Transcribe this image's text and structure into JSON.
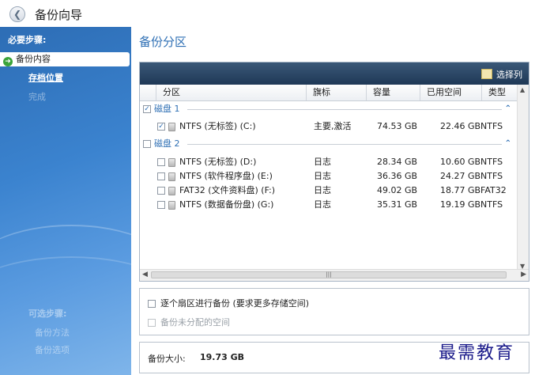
{
  "window": {
    "title": "备份向导"
  },
  "sidebar": {
    "required_heading": "必要步骤:",
    "items": [
      {
        "label": "备份内容",
        "state": "active"
      },
      {
        "label": "存档位置",
        "state": "link"
      },
      {
        "label": "完成",
        "state": "disabled"
      }
    ],
    "optional_heading": "可选步骤:",
    "optional_items": [
      "备份方法",
      "备份选项"
    ]
  },
  "main": {
    "title": "备份分区",
    "toolbar": {
      "select_columns": "选择列"
    },
    "columns": [
      "分区",
      "旗标",
      "容量",
      "已用空间",
      "类型"
    ],
    "disks": [
      {
        "label": "磁盘 1",
        "checked": true,
        "partitions": [
          {
            "name": "NTFS (无标签) (C:)",
            "flag": "主要,激活",
            "capacity": "74.53 GB",
            "used": "22.46 GB",
            "type": "NTFS",
            "checked": true
          }
        ]
      },
      {
        "label": "磁盘 2",
        "checked": false,
        "partitions": [
          {
            "name": "NTFS (无标签) (D:)",
            "flag": "日志",
            "capacity": "28.34 GB",
            "used": "10.60 GB",
            "type": "NTFS",
            "checked": false
          },
          {
            "name": "NTFS (软件程序盘) (E:)",
            "flag": "日志",
            "capacity": "36.36 GB",
            "used": "24.27 GB",
            "type": "NTFS",
            "checked": false
          },
          {
            "name": "FAT32 (文件资料盘) (F:)",
            "flag": "日志",
            "capacity": "49.02 GB",
            "used": "18.77 GB",
            "type": "FAT32",
            "checked": false
          },
          {
            "name": "NTFS (数据备份盘) (G:)",
            "flag": "日志",
            "capacity": "35.31 GB",
            "used": "19.19 GB",
            "type": "NTFS",
            "checked": false
          }
        ]
      }
    ],
    "options": {
      "sector_by_sector": "逐个扇区进行备份 (要求更多存储空间)",
      "backup_unallocated": "备份未分配的空间"
    },
    "backup_size_label": "备份大小:",
    "backup_size_value": "19.73 GB"
  },
  "watermark": "最需教育",
  "colors": {
    "accent": "#2e6fb4",
    "sidebar": "#3b83cf",
    "grid_header": "#2a4767"
  },
  "icons": [
    "back-arrow-icon",
    "arrow-right-icon",
    "select-columns-icon",
    "drive-icon",
    "chevron-up-icon"
  ]
}
